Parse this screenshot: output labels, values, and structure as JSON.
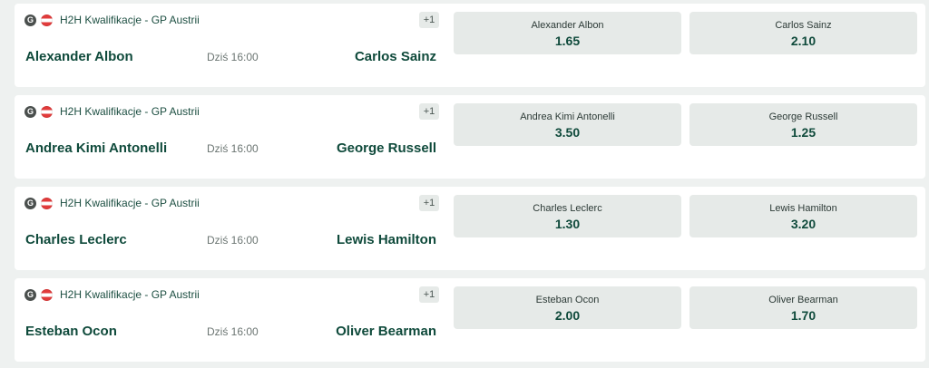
{
  "events": [
    {
      "sport_icon": "motorsport-icon",
      "flag": "austria-flag",
      "league": "H2H Kwalifikacje - GP Austrii",
      "more_markets": "+1",
      "home": "Alexander Albon",
      "time": "Dziś 16:00",
      "away": "Carlos Sainz",
      "odds": [
        {
          "label": "Alexander Albon",
          "value": "1.65"
        },
        {
          "label": "Carlos Sainz",
          "value": "2.10"
        }
      ]
    },
    {
      "sport_icon": "motorsport-icon",
      "flag": "austria-flag",
      "league": "H2H Kwalifikacje - GP Austrii",
      "more_markets": "+1",
      "home": "Andrea Kimi Antonelli",
      "time": "Dziś 16:00",
      "away": "George Russell",
      "odds": [
        {
          "label": "Andrea Kimi Antonelli",
          "value": "3.50"
        },
        {
          "label": "George Russell",
          "value": "1.25"
        }
      ]
    },
    {
      "sport_icon": "motorsport-icon",
      "flag": "austria-flag",
      "league": "H2H Kwalifikacje - GP Austrii",
      "more_markets": "+1",
      "home": "Charles Leclerc",
      "time": "Dziś 16:00",
      "away": "Lewis Hamilton",
      "odds": [
        {
          "label": "Charles Leclerc",
          "value": "1.30"
        },
        {
          "label": "Lewis Hamilton",
          "value": "3.20"
        }
      ]
    },
    {
      "sport_icon": "motorsport-icon",
      "flag": "austria-flag",
      "league": "H2H Kwalifikacje - GP Austrii",
      "more_markets": "+1",
      "home": "Esteban Ocon",
      "time": "Dziś 16:00",
      "away": "Oliver Bearman",
      "odds": [
        {
          "label": "Esteban Ocon",
          "value": "2.00"
        },
        {
          "label": "Oliver Bearman",
          "value": "1.70"
        }
      ]
    }
  ],
  "colors": {
    "page_bg": "#eef1f0",
    "card_bg": "#ffffff",
    "odd_bg": "#e6eae8",
    "accent_text": "#0f4a3b",
    "flag_red": "#e23b3b"
  }
}
